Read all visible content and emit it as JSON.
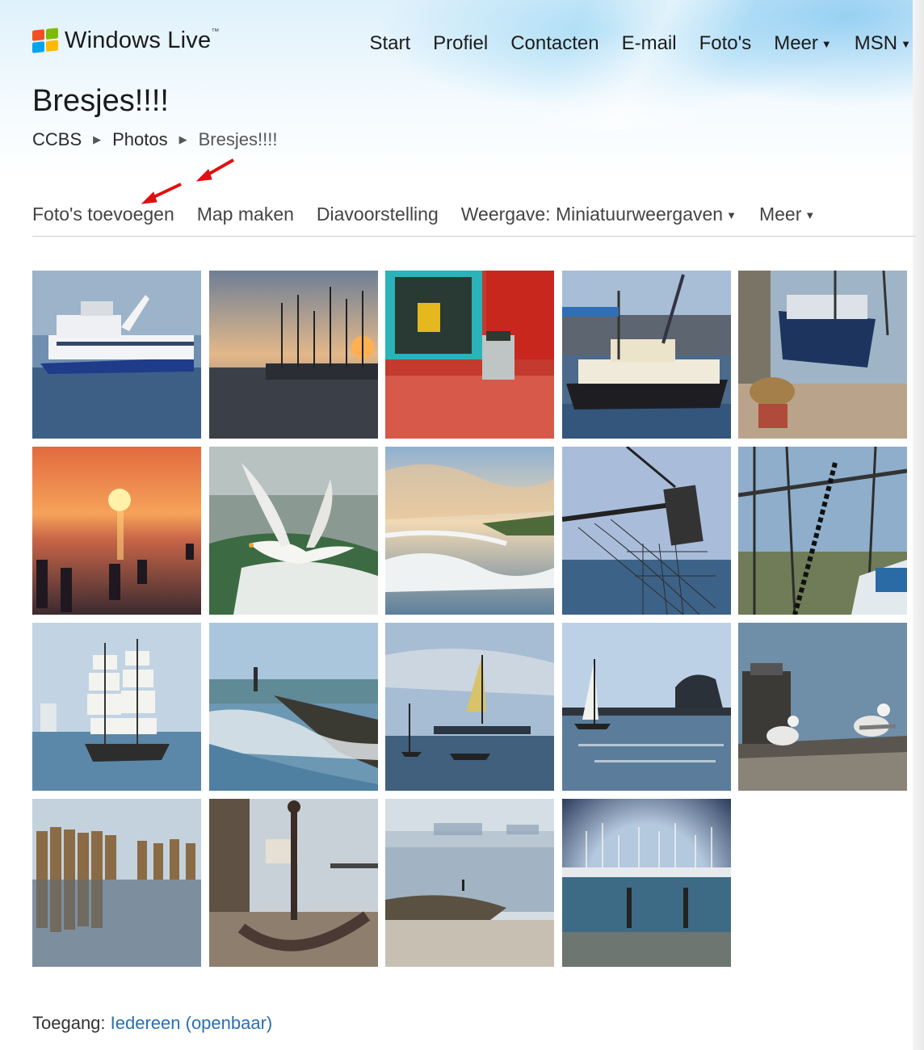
{
  "header": {
    "logo_text": "Windows Live",
    "logo_tm": "™",
    "nav": [
      {
        "label": "Start",
        "caret": false
      },
      {
        "label": "Profiel",
        "caret": false
      },
      {
        "label": "Contacten",
        "caret": false
      },
      {
        "label": "E-mail",
        "caret": false
      },
      {
        "label": "Foto's",
        "caret": false
      },
      {
        "label": "Meer",
        "caret": true
      },
      {
        "label": "MSN",
        "caret": true
      }
    ]
  },
  "page": {
    "title": "Bresjes!!!!",
    "breadcrumb": [
      "CCBS",
      "Photos",
      "Bresjes!!!!"
    ]
  },
  "toolbar": {
    "items": [
      {
        "label": "Foto's toevoegen",
        "caret": false
      },
      {
        "label": "Map maken",
        "caret": false
      },
      {
        "label": "Diavoorstelling",
        "caret": false
      },
      {
        "label": "Weergave: Miniatuurweergaven",
        "caret": true
      },
      {
        "label": "Meer",
        "caret": true
      }
    ]
  },
  "annotation": {
    "arrow_color": "#e01010"
  },
  "gallery": {
    "photos": [
      {
        "name": "ferry-photo",
        "scene": "ferry"
      },
      {
        "name": "harbor-sunset-masts-photo",
        "scene": "masts-sunset"
      },
      {
        "name": "red-door-shoes-photo",
        "scene": "red-door"
      },
      {
        "name": "fishing-boat-harbor-photo",
        "scene": "fishing-boat"
      },
      {
        "name": "trawler-quay-photo",
        "scene": "trawler"
      },
      {
        "name": "sunset-sea-poles-photo",
        "scene": "sunset"
      },
      {
        "name": "seagull-flying-photo",
        "scene": "seagull"
      },
      {
        "name": "beach-waves-photo",
        "scene": "beach"
      },
      {
        "name": "fishing-net-photo",
        "scene": "net"
      },
      {
        "name": "trawler-rigging-photo",
        "scene": "rigging"
      },
      {
        "name": "tall-ship-photo",
        "scene": "tallship"
      },
      {
        "name": "breakwater-photo",
        "scene": "breakwater"
      },
      {
        "name": "sailboats-photo",
        "scene": "sailboats"
      },
      {
        "name": "sailboat-harbor-photo",
        "scene": "sailboat2"
      },
      {
        "name": "seagulls-bollard-photo",
        "scene": "gulls"
      },
      {
        "name": "wooden-poles-reflection-photo",
        "scene": "poles"
      },
      {
        "name": "anchor-photo",
        "scene": "anchor"
      },
      {
        "name": "shoreline-figure-photo",
        "scene": "shore"
      },
      {
        "name": "marina-photo",
        "scene": "marina"
      }
    ]
  },
  "footer": {
    "access_label": "Toegang:",
    "access_value": "Iedereen (openbaar)"
  }
}
